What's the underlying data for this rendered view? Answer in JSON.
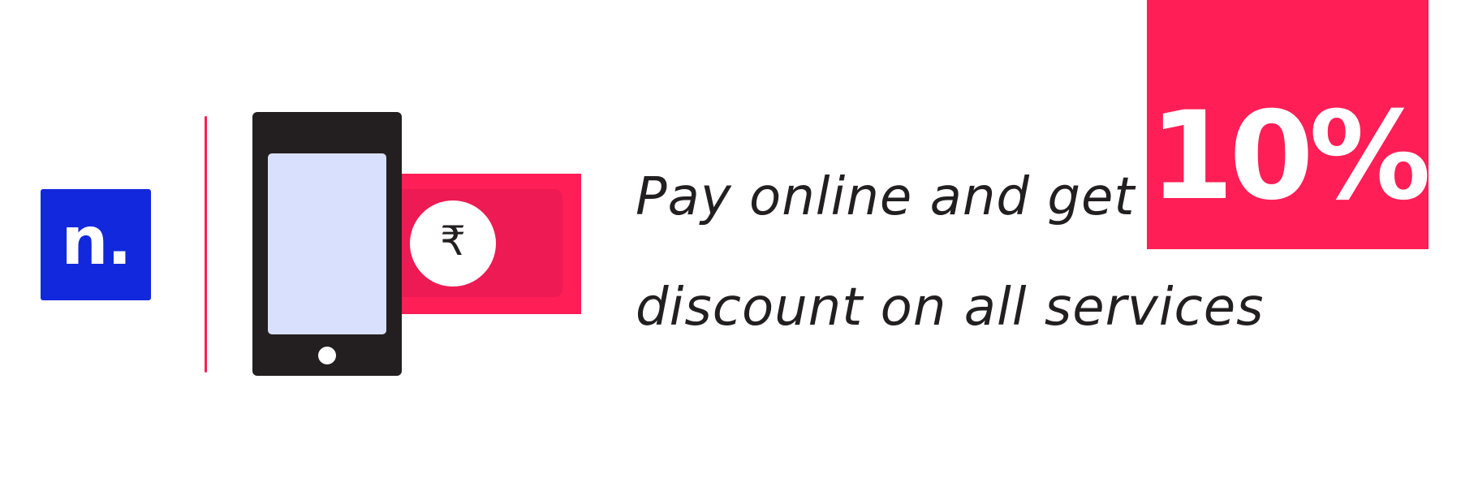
{
  "brand": {
    "logo_text": "n.",
    "color": "#1228dc"
  },
  "illustration": {
    "currency_symbol": "₹",
    "accent_color": "#ff1e56",
    "phone_color": "#231f20",
    "screen_color": "#d8e0fd",
    "icons": [
      "phone-icon",
      "banknote-icon",
      "rupee-icon"
    ]
  },
  "promo": {
    "line1": "Pay online and get",
    "line2": "discount on all services",
    "discount": "10%",
    "badge_color": "#ff1e56"
  }
}
